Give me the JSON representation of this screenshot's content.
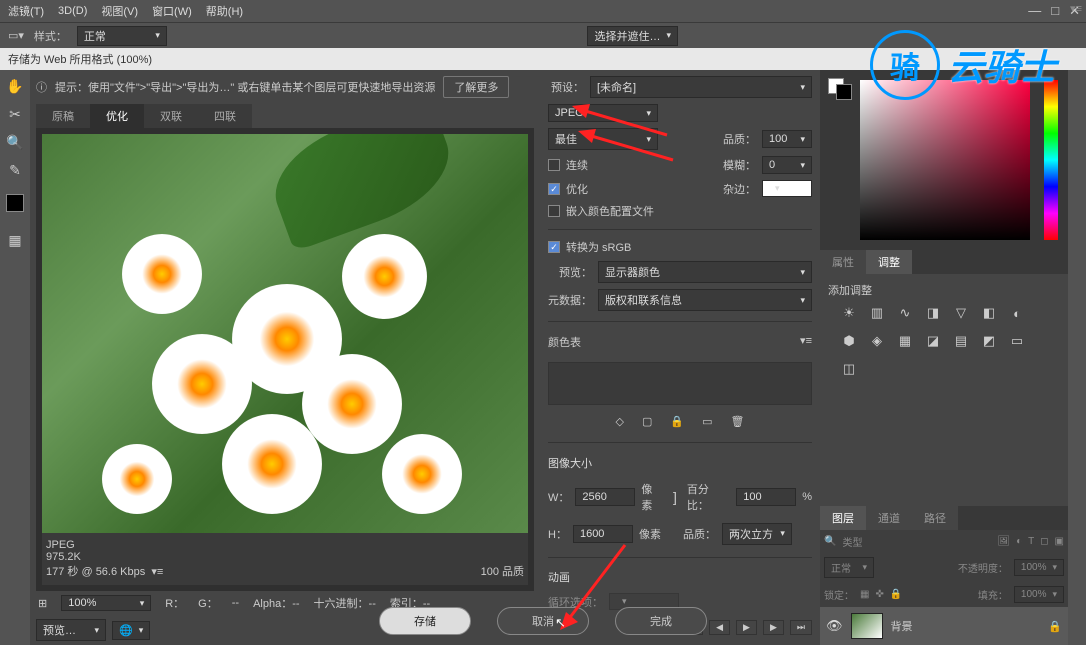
{
  "menu": {
    "items": [
      "滤镜(T)",
      "3D(D)",
      "视图(V)",
      "窗口(W)",
      "帮助(H)"
    ]
  },
  "options": {
    "style_lbl": "样式：",
    "style_val": "正常",
    "select_mask": "选择并遮住…"
  },
  "dialog": {
    "title": "存储为 Web 所用格式 (100%)"
  },
  "hint": {
    "prefix": "提示：使用\"文件\">\"导出\">\"导出为…\" 或右键单击某个图层可更快速地导出资源",
    "learn": "了解更多"
  },
  "tabs": {
    "original": "原稿",
    "optimized": "优化",
    "two_up": "双联",
    "four_up": "四联"
  },
  "info": {
    "format": "JPEG",
    "size": "975.2K",
    "speed": "177 秒 @ 56.6 Kbps",
    "quality": "100 品质"
  },
  "zoom": {
    "val": "100%",
    "R": "R：",
    "G": "G：",
    "B": "--",
    "Alpha": "Alpha：--",
    "hex": "十六进制：--",
    "index": "索引：--"
  },
  "preview_btn": "预览…",
  "preset": {
    "lbl": "预设：",
    "val": "[未命名]"
  },
  "fmt": {
    "val": "JPEG"
  },
  "quality": {
    "val": "最佳"
  },
  "opts": {
    "progressive": "连续",
    "optimized": "优化",
    "embed": "嵌入颜色配置文件",
    "qlbl": "品质：",
    "qval": "100",
    "blur": "模糊：",
    "bval": "0",
    "matte": "杂边："
  },
  "convert": {
    "srgb": "转换为 sRGB",
    "preview_lbl": "预览：",
    "preview_val": "显示器颜色",
    "meta_lbl": "元数据：",
    "meta_val": "版权和联系信息"
  },
  "ctable": "颜色表",
  "imgsize": {
    "title": "图像大小",
    "w": "W：",
    "wval": "2560",
    "h": "H：",
    "hval": "1600",
    "px": "像素",
    "pct_lbl": "百分比：",
    "pct_val": "100",
    "q_lbl": "品质：",
    "q_val": "两次立方"
  },
  "anim": {
    "title": "动画",
    "loop": "循环选项："
  },
  "btns": {
    "save": "存储",
    "cancel": "取消",
    "done": "完成"
  },
  "panels": {
    "props": "属性",
    "adjust": "调整",
    "add_adj": "添加调整",
    "layers": "图层",
    "channels": "通道",
    "paths": "路径",
    "kind": "类型",
    "blend": "正常",
    "opacity_lbl": "不透明度：",
    "opacity": "100%",
    "lock": "锁定：",
    "fill_lbl": "填充：",
    "fill": "100%",
    "bg_layer": "背景"
  },
  "logo": "云骑士"
}
